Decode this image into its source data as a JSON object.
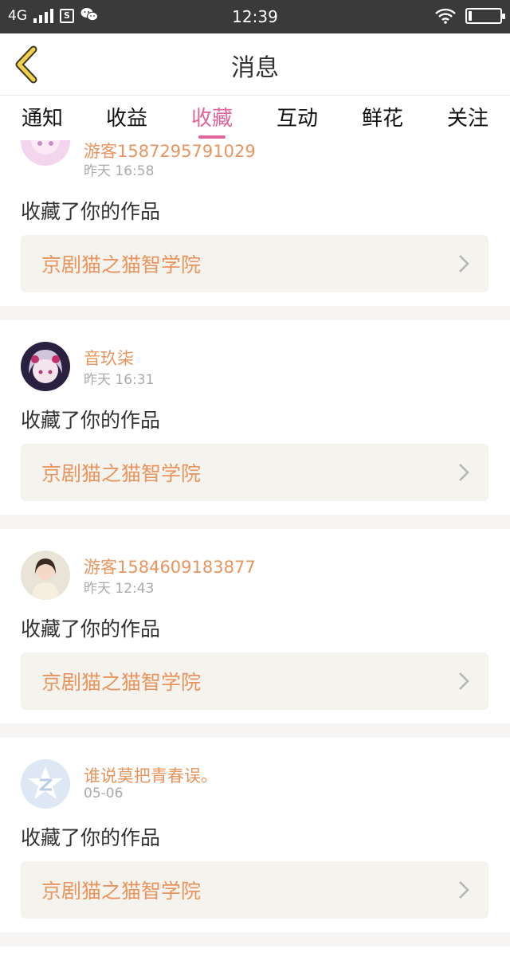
{
  "status_bar": {
    "network": "4G",
    "sim_icon": "S",
    "time": "12:39",
    "icons": [
      "signal-icon",
      "sim-icon",
      "wechat-icon",
      "wifi-icon",
      "battery-icon"
    ]
  },
  "header": {
    "title": "消息",
    "back_icon": "back-chevron-icon"
  },
  "tabs": [
    {
      "label": "通知",
      "active": false
    },
    {
      "label": "收益",
      "active": false
    },
    {
      "label": "收藏",
      "active": true
    },
    {
      "label": "互动",
      "active": false
    },
    {
      "label": "鲜花",
      "active": false
    },
    {
      "label": "关注",
      "active": false
    }
  ],
  "colors": {
    "accent_pink": "#e0659a",
    "name_orange": "#e8945e",
    "work_bg": "#f4f3ee"
  },
  "messages": [
    {
      "user": "游客15872957910​29",
      "time": "昨天 16:58",
      "action": "收藏了你的作品",
      "work": "京剧猫之猫智学院"
    },
    {
      "user": "音玖柒",
      "time": "昨天 16:31",
      "action": "收藏了你的作品",
      "work": "京剧猫之猫智学院"
    },
    {
      "user": "游客1584609183877",
      "time": "昨天 12:43",
      "action": "收藏了你的作品",
      "work": "京剧猫之猫智学院"
    },
    {
      "user": "谁说莫把青春误。",
      "time": "05-06",
      "action": "收藏了你的作品",
      "work": "京剧猫之猫智学院"
    }
  ]
}
